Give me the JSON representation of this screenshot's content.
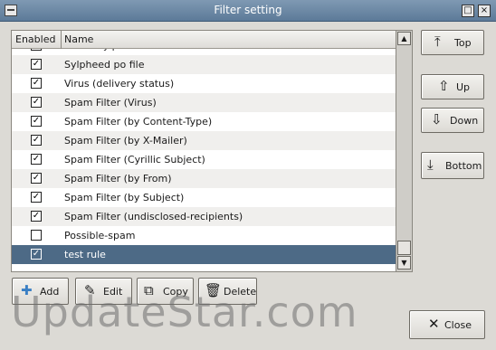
{
  "window": {
    "title": "Filter setting",
    "maximize_glyph": "□",
    "close_glyph": "×"
  },
  "list": {
    "headers": {
      "enabled": "Enabled",
      "name": "Name"
    },
    "rows": [
      {
        "name": "About Sylpheed",
        "checked": true
      },
      {
        "name": "Sylpheed po file",
        "checked": true
      },
      {
        "name": "Virus (delivery status)",
        "checked": true
      },
      {
        "name": "Spam Filter (Virus)",
        "checked": true
      },
      {
        "name": "Spam Filter (by Content-Type)",
        "checked": true
      },
      {
        "name": "Spam Filter (by X-Mailer)",
        "checked": true
      },
      {
        "name": "Spam Filter (Cyrillic Subject)",
        "checked": true
      },
      {
        "name": "Spam Filter (by From)",
        "checked": true
      },
      {
        "name": "Spam Filter (by Subject)",
        "checked": true
      },
      {
        "name": "Spam Filter (undisclosed-recipients)",
        "checked": true
      },
      {
        "name": "Possible-spam",
        "checked": false
      },
      {
        "name": "test rule",
        "checked": true,
        "selected": true
      }
    ]
  },
  "buttons": {
    "top": "Top",
    "up": "Up",
    "down": "Down",
    "bottom": "Bottom",
    "add": "Add",
    "edit": "Edit",
    "copy": "Copy",
    "delete": "Delete",
    "close": "Close"
  },
  "watermark": "UpdateStar.com",
  "colors": {
    "selection": "#4d6a86",
    "titlebar": "#6b87a3"
  }
}
